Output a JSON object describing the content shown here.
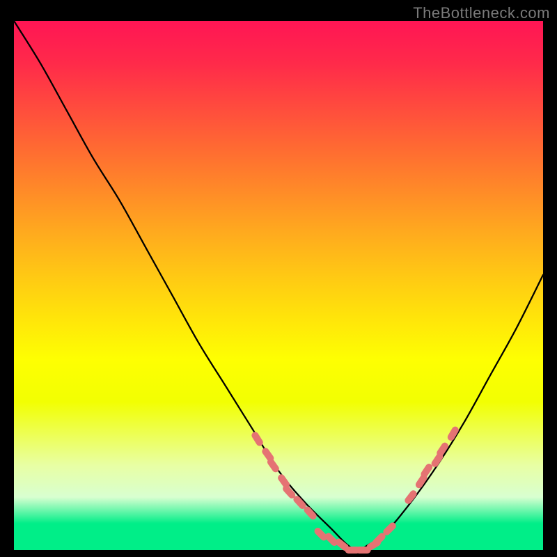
{
  "watermark": "TheBottleneck.com",
  "chart_data": {
    "type": "line",
    "title": "",
    "xlabel": "",
    "ylabel": "",
    "xlim": [
      0,
      100
    ],
    "ylim": [
      0,
      100
    ],
    "series": [
      {
        "name": "bottleneck-curve",
        "x": [
          0,
          5,
          10,
          15,
          20,
          25,
          30,
          35,
          40,
          45,
          50,
          55,
          60,
          63,
          65,
          67,
          70,
          75,
          80,
          85,
          90,
          95,
          100
        ],
        "y": [
          100,
          92,
          83,
          74,
          66,
          57,
          48,
          39,
          31,
          23,
          15,
          9,
          4,
          1,
          0,
          1,
          3,
          9,
          16,
          24,
          33,
          42,
          52
        ]
      }
    ],
    "marker_clusters": [
      {
        "name": "left-cluster",
        "points": [
          {
            "x": 46,
            "y": 21
          },
          {
            "x": 48,
            "y": 18
          },
          {
            "x": 49,
            "y": 16
          },
          {
            "x": 51,
            "y": 13
          },
          {
            "x": 52,
            "y": 11
          },
          {
            "x": 54,
            "y": 9
          },
          {
            "x": 56,
            "y": 7
          }
        ],
        "size": 10
      },
      {
        "name": "bottom-cluster",
        "points": [
          {
            "x": 58,
            "y": 3
          },
          {
            "x": 60,
            "y": 2
          },
          {
            "x": 62,
            "y": 1
          },
          {
            "x": 64,
            "y": 0
          },
          {
            "x": 66,
            "y": 0
          },
          {
            "x": 68,
            "y": 1
          },
          {
            "x": 69,
            "y": 2
          },
          {
            "x": 71,
            "y": 4
          }
        ],
        "size": 10
      },
      {
        "name": "right-cluster",
        "points": [
          {
            "x": 75,
            "y": 10
          },
          {
            "x": 77,
            "y": 13
          },
          {
            "x": 78,
            "y": 15
          },
          {
            "x": 80,
            "y": 17
          },
          {
            "x": 81,
            "y": 19
          },
          {
            "x": 83,
            "y": 22
          }
        ],
        "size": 10
      }
    ],
    "background_gradient": {
      "top": "#ff1554",
      "mid": "#ffe40a",
      "bottom": "#00ee88"
    }
  }
}
